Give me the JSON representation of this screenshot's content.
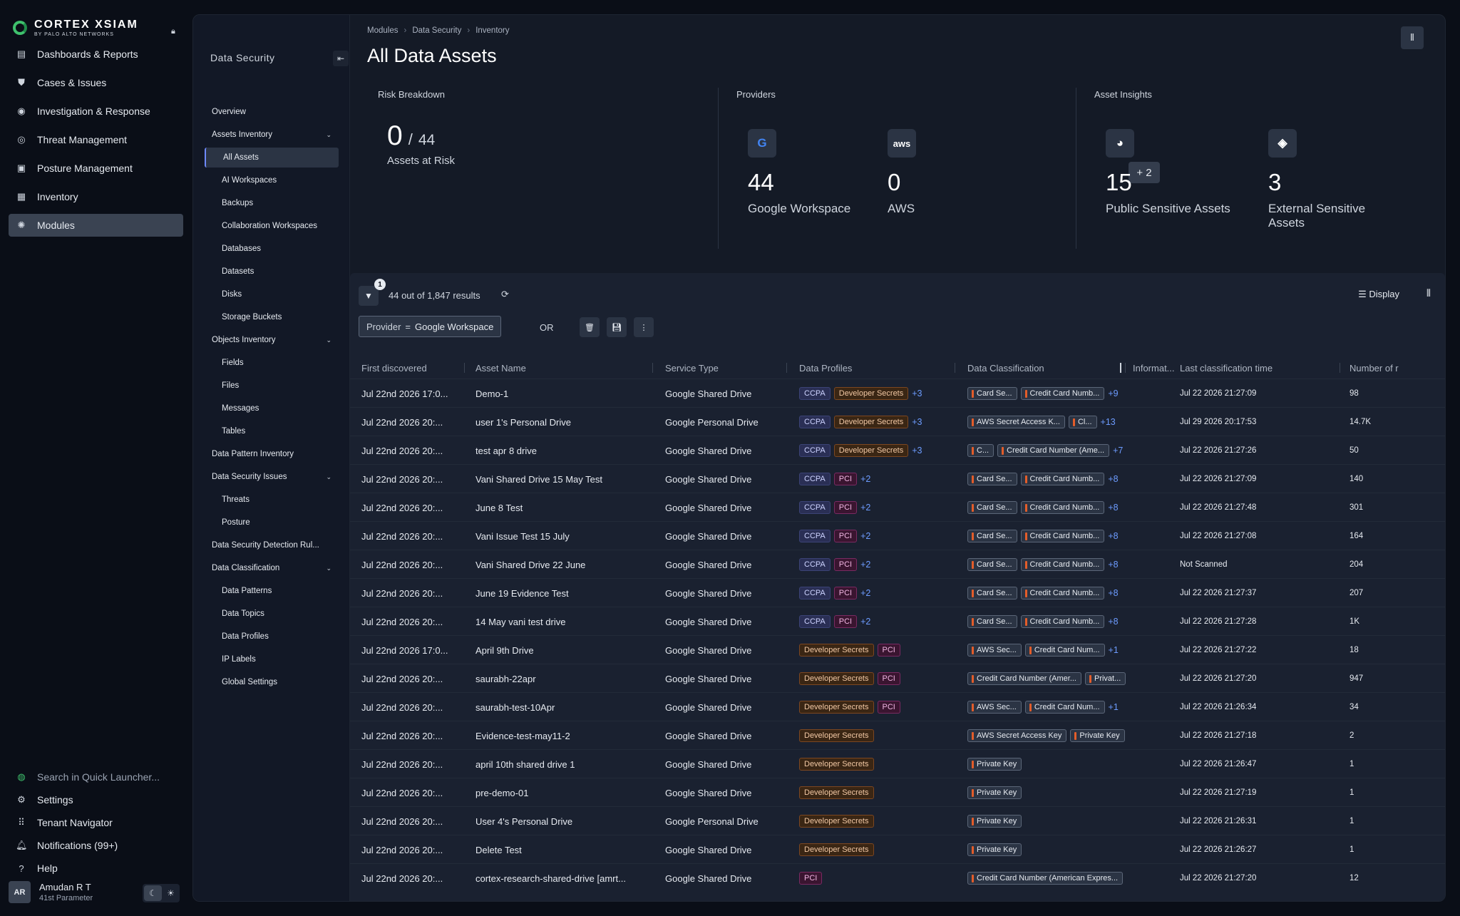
{
  "app": {
    "brand": "CORTEX XSIAM",
    "brand_sub": "BY PALO ALTO NETWORKS"
  },
  "global_nav": [
    {
      "label": "Dashboards & Reports",
      "icon": "dashboard-icon"
    },
    {
      "label": "Cases & Issues",
      "icon": "shield-alert-icon"
    },
    {
      "label": "Investigation & Response",
      "icon": "eye-icon"
    },
    {
      "label": "Threat Management",
      "icon": "target-icon"
    },
    {
      "label": "Posture Management",
      "icon": "clipboard-icon"
    },
    {
      "label": "Inventory",
      "icon": "inventory-icon"
    },
    {
      "label": "Modules",
      "icon": "modules-icon",
      "active": true
    }
  ],
  "global_nav_bottom": [
    {
      "label": "Search in Quick Launcher...",
      "icon": "quick-launcher-icon"
    },
    {
      "label": "Settings",
      "icon": "gear-icon"
    },
    {
      "label": "Tenant Navigator",
      "icon": "grid-icon"
    },
    {
      "label": "Notifications (99+)",
      "icon": "bell-icon"
    },
    {
      "label": "Help",
      "icon": "help-icon"
    }
  ],
  "user": {
    "initials": "AR",
    "name": "Amudan R T",
    "tenant": "41st Parameter"
  },
  "module_sidebar": {
    "title": "Data Security",
    "items": [
      {
        "label": "Overview",
        "level": 1
      },
      {
        "label": "Assets Inventory",
        "level": 1,
        "expandable": true
      },
      {
        "label": "All Assets",
        "level": 2,
        "active": true
      },
      {
        "label": "AI Workspaces",
        "level": 2
      },
      {
        "label": "Backups",
        "level": 2
      },
      {
        "label": "Collaboration Workspaces",
        "level": 2
      },
      {
        "label": "Databases",
        "level": 2
      },
      {
        "label": "Datasets",
        "level": 2
      },
      {
        "label": "Disks",
        "level": 2
      },
      {
        "label": "Storage Buckets",
        "level": 2
      },
      {
        "label": "Objects Inventory",
        "level": 1,
        "expandable": true
      },
      {
        "label": "Fields",
        "level": 2
      },
      {
        "label": "Files",
        "level": 2
      },
      {
        "label": "Messages",
        "level": 2
      },
      {
        "label": "Tables",
        "level": 2
      },
      {
        "label": "Data Pattern Inventory",
        "level": 1
      },
      {
        "label": "Data Security Issues",
        "level": 1,
        "expandable": true
      },
      {
        "label": "Threats",
        "level": 2
      },
      {
        "label": "Posture",
        "level": 2
      },
      {
        "label": "Data Security Detection Rul...",
        "level": 1
      },
      {
        "label": "Data Classification",
        "level": 1,
        "expandable": true
      },
      {
        "label": "Data Patterns",
        "level": 2
      },
      {
        "label": "Data Topics",
        "level": 2
      },
      {
        "label": "Data Profiles",
        "level": 2
      },
      {
        "label": "IP Labels",
        "level": 2
      },
      {
        "label": "Global Settings",
        "level": 2
      }
    ]
  },
  "breadcrumb": [
    "Modules",
    "Data Security",
    "Inventory"
  ],
  "page_title": "All Data Assets",
  "risk": {
    "title": "Risk Breakdown",
    "at_risk": "0",
    "total": "44",
    "label": "Assets at Risk"
  },
  "providers": {
    "title": "Providers",
    "items": [
      {
        "count": "44",
        "label": "Google Workspace",
        "icon": "google-icon"
      },
      {
        "count": "0",
        "label": "AWS",
        "icon": "aws-icon"
      }
    ],
    "more": "+ 2"
  },
  "insights": {
    "title": "Asset Insights",
    "items": [
      {
        "count": "15",
        "label": "Public Sensitive Assets",
        "icon": "globe-icon"
      },
      {
        "count": "3",
        "label": "External Sensitive Assets",
        "icon": "diamond-icon"
      }
    ]
  },
  "toolbar": {
    "filter_count": "1",
    "results": "44 out of 1,847 results",
    "display": "Display",
    "or": "OR",
    "filter_chip": {
      "key": "Provider",
      "op": "=",
      "value": "Google Workspace"
    }
  },
  "table": {
    "columns": [
      "First discovered",
      "Asset Name",
      "Service Type",
      "Data Profiles",
      "Data Classification",
      "Informat...",
      "Last classification time",
      "Number of r"
    ],
    "rows": [
      {
        "first": "Jul 22nd 2026 17:0...",
        "name": "Demo-1",
        "service": "Google Shared Drive",
        "profiles": [
          "CCPA",
          "Developer Secrets"
        ],
        "profiles_more": "+3",
        "classes": [
          "Card Se...",
          "Credit Card Numb..."
        ],
        "classes_more": "+9",
        "last": "Jul 22 2026 21:27:09",
        "num": "98"
      },
      {
        "first": "Jul 22nd 2026 20:...",
        "name": "user 1's Personal Drive",
        "service": "Google Personal Drive",
        "profiles": [
          "CCPA",
          "Developer Secrets"
        ],
        "profiles_more": "+3",
        "classes": [
          "AWS Secret Access K...",
          "Cl..."
        ],
        "classes_more": "+13",
        "last": "Jul 29 2026 20:17:53",
        "num": "14.7K"
      },
      {
        "first": "Jul 22nd 2026 20:...",
        "name": "test apr 8 drive",
        "service": "Google Shared Drive",
        "profiles": [
          "CCPA",
          "Developer Secrets"
        ],
        "profiles_more": "+3",
        "classes": [
          "C...",
          "Credit Card Number (Ame..."
        ],
        "classes_more": "+7",
        "last": "Jul 22 2026 21:27:26",
        "num": "50"
      },
      {
        "first": "Jul 22nd 2026 20:...",
        "name": "Vani Shared Drive 15 May Test",
        "service": "Google Shared Drive",
        "profiles": [
          "CCPA",
          "PCI"
        ],
        "profiles_more": "+2",
        "classes": [
          "Card Se...",
          "Credit Card Numb..."
        ],
        "classes_more": "+8",
        "last": "Jul 22 2026 21:27:09",
        "num": "140"
      },
      {
        "first": "Jul 22nd 2026 20:...",
        "name": "June 8 Test",
        "service": "Google Shared Drive",
        "profiles": [
          "CCPA",
          "PCI"
        ],
        "profiles_more": "+2",
        "classes": [
          "Card Se...",
          "Credit Card Numb..."
        ],
        "classes_more": "+8",
        "last": "Jul 22 2026 21:27:48",
        "num": "301"
      },
      {
        "first": "Jul 22nd 2026 20:...",
        "name": "Vani Issue Test 15 July",
        "service": "Google Shared Drive",
        "profiles": [
          "CCPA",
          "PCI"
        ],
        "profiles_more": "+2",
        "classes": [
          "Card Se...",
          "Credit Card Numb..."
        ],
        "classes_more": "+8",
        "last": "Jul 22 2026 21:27:08",
        "num": "164"
      },
      {
        "first": "Jul 22nd 2026 20:...",
        "name": "Vani Shared Drive 22 June",
        "service": "Google Shared Drive",
        "profiles": [
          "CCPA",
          "PCI"
        ],
        "profiles_more": "+2",
        "classes": [
          "Card Se...",
          "Credit Card Numb..."
        ],
        "classes_more": "+8",
        "last": "Not Scanned",
        "num": "204"
      },
      {
        "first": "Jul 22nd 2026 20:...",
        "name": "June 19 Evidence Test",
        "service": "Google Shared Drive",
        "profiles": [
          "CCPA",
          "PCI"
        ],
        "profiles_more": "+2",
        "classes": [
          "Card Se...",
          "Credit Card Numb..."
        ],
        "classes_more": "+8",
        "last": "Jul 22 2026 21:27:37",
        "num": "207"
      },
      {
        "first": "Jul 22nd 2026 20:...",
        "name": "14 May vani test drive",
        "service": "Google Shared Drive",
        "profiles": [
          "CCPA",
          "PCI"
        ],
        "profiles_more": "+2",
        "classes": [
          "Card Se...",
          "Credit Card Numb..."
        ],
        "classes_more": "+8",
        "last": "Jul 22 2026 21:27:28",
        "num": "1K"
      },
      {
        "first": "Jul 22nd 2026 17:0...",
        "name": "April 9th Drive",
        "service": "Google Shared Drive",
        "profiles": [
          "Developer Secrets",
          "PCI"
        ],
        "profiles_more": "",
        "classes": [
          "AWS Sec...",
          "Credit Card Num..."
        ],
        "classes_more": "+1",
        "last": "Jul 22 2026 21:27:22",
        "num": "18"
      },
      {
        "first": "Jul 22nd 2026 20:...",
        "name": "saurabh-22apr",
        "service": "Google Shared Drive",
        "profiles": [
          "Developer Secrets",
          "PCI"
        ],
        "profiles_more": "",
        "classes": [
          "Credit Card Number (Amer...",
          "Privat..."
        ],
        "classes_more": "",
        "last": "Jul 22 2026 21:27:20",
        "num": "947"
      },
      {
        "first": "Jul 22nd 2026 20:...",
        "name": "saurabh-test-10Apr",
        "service": "Google Shared Drive",
        "profiles": [
          "Developer Secrets",
          "PCI"
        ],
        "profiles_more": "",
        "classes": [
          "AWS Sec...",
          "Credit Card Num..."
        ],
        "classes_more": "+1",
        "last": "Jul 22 2026 21:26:34",
        "num": "34"
      },
      {
        "first": "Jul 22nd 2026 20:...",
        "name": "Evidence-test-may11-2",
        "service": "Google Shared Drive",
        "profiles": [
          "Developer Secrets"
        ],
        "profiles_more": "",
        "classes": [
          "AWS Secret Access Key",
          "Private Key"
        ],
        "classes_more": "",
        "last": "Jul 22 2026 21:27:18",
        "num": "2"
      },
      {
        "first": "Jul 22nd 2026 20:...",
        "name": "april 10th shared drive 1",
        "service": "Google Shared Drive",
        "profiles": [
          "Developer Secrets"
        ],
        "profiles_more": "",
        "classes": [
          "Private Key"
        ],
        "classes_more": "",
        "last": "Jul 22 2026 21:26:47",
        "num": "1"
      },
      {
        "first": "Jul 22nd 2026 20:...",
        "name": "pre-demo-01",
        "service": "Google Shared Drive",
        "profiles": [
          "Developer Secrets"
        ],
        "profiles_more": "",
        "classes": [
          "Private Key"
        ],
        "classes_more": "",
        "last": "Jul 22 2026 21:27:19",
        "num": "1"
      },
      {
        "first": "Jul 22nd 2026 20:...",
        "name": "User 4's Personal Drive",
        "service": "Google Personal Drive",
        "profiles": [
          "Developer Secrets"
        ],
        "profiles_more": "",
        "classes": [
          "Private Key"
        ],
        "classes_more": "",
        "last": "Jul 22 2026 21:26:31",
        "num": "1"
      },
      {
        "first": "Jul 22nd 2026 20:...",
        "name": "Delete Test",
        "service": "Google Shared Drive",
        "profiles": [
          "Developer Secrets"
        ],
        "profiles_more": "",
        "classes": [
          "Private Key"
        ],
        "classes_more": "",
        "last": "Jul 22 2026 21:26:27",
        "num": "1"
      },
      {
        "first": "Jul 22nd 2026 20:...",
        "name": "cortex-research-shared-drive [amrt...",
        "service": "Google Shared Drive",
        "profiles": [
          "PCI"
        ],
        "profiles_more": "",
        "classes": [
          "Credit Card Number (American Expres..."
        ],
        "classes_more": "",
        "last": "Jul 22 2026 21:27:20",
        "num": "12"
      }
    ]
  },
  "colors": {
    "accent": "#6e89ff",
    "bg": "#0a0e17",
    "panel": "#141a26",
    "more_link": "#6d9cff"
  }
}
